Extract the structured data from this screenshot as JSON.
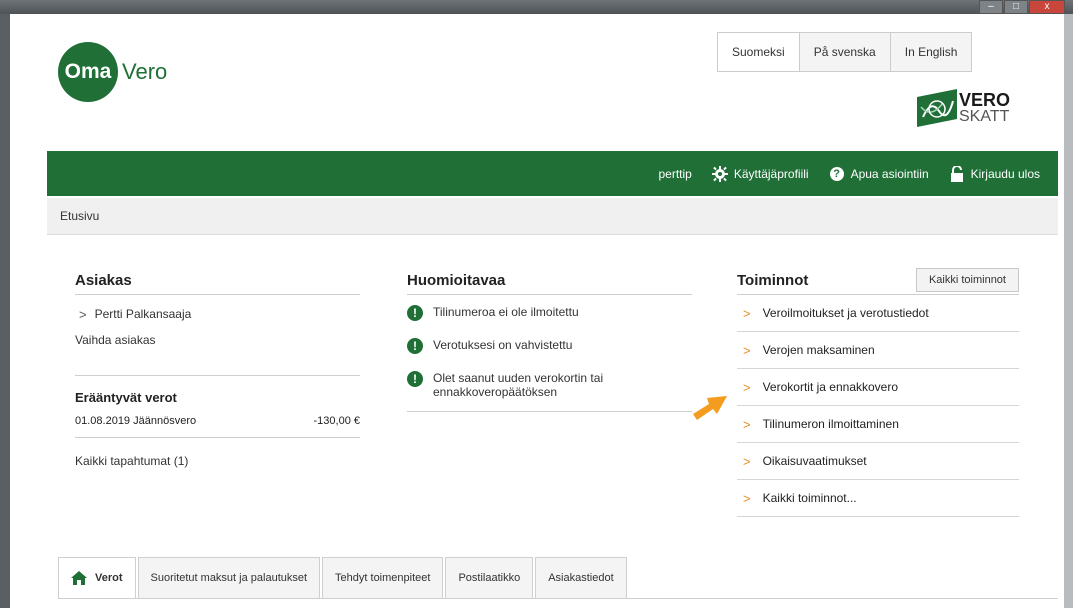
{
  "window": {
    "min": "–",
    "max": "□",
    "close": "x"
  },
  "header": {
    "logo_oma": "Oma",
    "logo_vero": "Vero",
    "languages": [
      "Suomeksi",
      "På svenska",
      "In English"
    ],
    "vero_logo": {
      "line1": "VERO",
      "line2": "SKATT"
    }
  },
  "nav": {
    "user": "perttip",
    "profile": "Käyttäjäprofiili",
    "help": "Apua asiointiin",
    "logout": "Kirjaudu ulos"
  },
  "breadcrumb": "Etusivu",
  "asiakas": {
    "title": "Asiakas",
    "customer_name": "Pertti Palkansaaja",
    "change_customer": "Vaihda asiakas",
    "due_title": "Erääntyvät verot",
    "due_item_label": "01.08.2019 Jäännösvero",
    "due_item_amount": "-130,00 €",
    "all_events": "Kaikki tapahtumat (1)"
  },
  "huomioitavaa": {
    "title": "Huomioitavaa",
    "items": [
      "Tilinumeroa ei ole ilmoitettu",
      "Verotuksesi on vahvistettu",
      "Olet saanut uuden verokortin tai ennakkoveropäätöksen"
    ]
  },
  "toiminnot": {
    "title": "Toiminnot",
    "all_button": "Kaikki toiminnot",
    "items": [
      "Veroilmoitukset ja verotustiedot",
      "Verojen maksaminen",
      "Verokortit ja ennakkovero",
      "Tilinumeron ilmoittaminen",
      "Oikaisuvaatimukset",
      "Kaikki toiminnot..."
    ]
  },
  "tabs": [
    "Verot",
    "Suoritetut maksut ja palautukset",
    "Tehdyt toimenpiteet",
    "Postilaatikko",
    "Asiakastiedot"
  ],
  "colors": {
    "brand_green": "#1f6f37",
    "accent_orange": "#f39c1f"
  }
}
